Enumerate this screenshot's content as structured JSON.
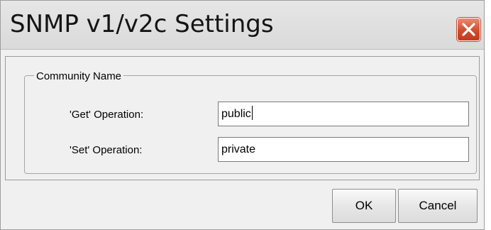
{
  "dialog": {
    "title": "SNMP v1/v2c Settings",
    "close_icon": "close-icon",
    "close_color": "#d04d2e"
  },
  "community_group": {
    "legend": "Community Name",
    "get_label": "'Get' Operation:",
    "get_value": "public",
    "set_label": "'Set' Operation:",
    "set_value": "private"
  },
  "buttons": {
    "ok_label": "OK",
    "cancel_label": "Cancel"
  }
}
